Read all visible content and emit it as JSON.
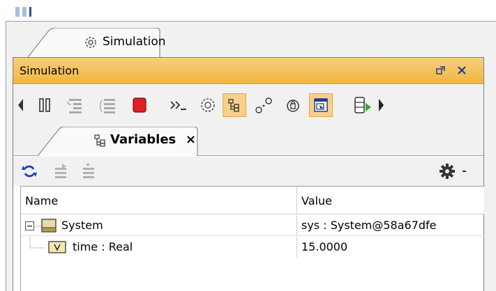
{
  "outer_tab": {
    "label": "Simulation",
    "icon": "simulation-gear-icon"
  },
  "panel": {
    "title": "Simulation",
    "header_buttons": [
      "restore-icon",
      "close-icon"
    ],
    "toolbar": {
      "buttons": [
        {
          "name": "scroll-left-icon",
          "active": false
        },
        {
          "name": "pause-icon",
          "active": false
        },
        {
          "name": "step-into-icon",
          "active": false
        },
        {
          "name": "step-over-icon",
          "active": false
        },
        {
          "name": "terminate-icon",
          "active": false
        },
        {
          "name": "console-icon",
          "active": false
        },
        {
          "name": "sessions-icon",
          "active": false
        },
        {
          "name": "variables-icon",
          "active": true
        },
        {
          "name": "breakpoints-icon",
          "active": false
        },
        {
          "name": "triggers-icon",
          "active": false
        },
        {
          "name": "ui-icon",
          "active": true
        },
        {
          "name": "run-configuration-icon",
          "active": false
        },
        {
          "name": "scroll-right-icon",
          "active": false
        }
      ]
    }
  },
  "inner_tab": {
    "label": "Variables",
    "close": "×",
    "icon": "variables-tree-icon"
  },
  "sub_toolbar": {
    "buttons": [
      "refresh-icon",
      "export-icon",
      "import-icon"
    ],
    "options": "gear-icon"
  },
  "table": {
    "headers": {
      "name": "Name",
      "value": "Value"
    },
    "rows": [
      {
        "name": "System",
        "value": "sys : System@58a67dfe",
        "icon": "block-icon",
        "expanded": true,
        "level": 0
      },
      {
        "name": "time : Real",
        "value": "15.0000",
        "icon": "value-property-icon",
        "level": 1
      }
    ]
  },
  "colors": {
    "header_gradient_top": "#f7cf7c",
    "header_gradient_bottom": "#f2b540",
    "active_button": "#f7d08a",
    "stop_red": "#e02020"
  }
}
